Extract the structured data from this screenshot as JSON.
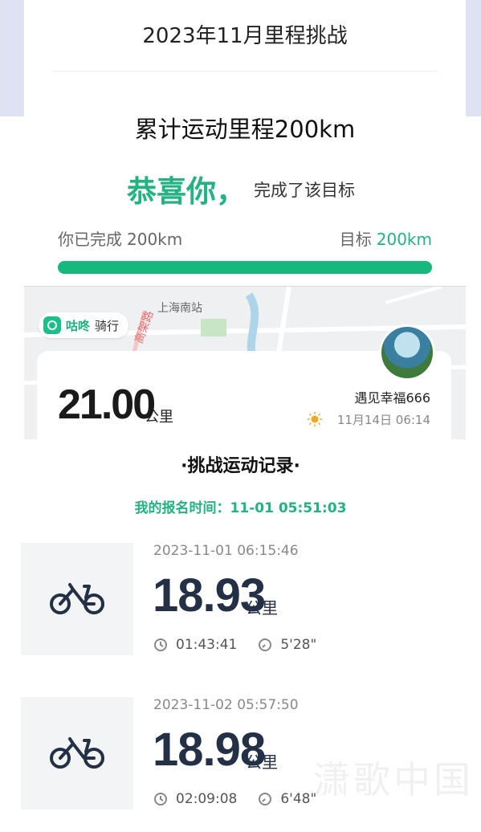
{
  "challenge": {
    "title": "2023年11月里程挑战",
    "goal_text": "累计运动里程200km",
    "congrats": "恭喜你，",
    "congrats_sub": "完成了该目标",
    "completed_label": "你已完成",
    "completed_value": "200km",
    "target_label": "目标",
    "target_value": "200km",
    "progress": 1.0
  },
  "map": {
    "place_label": "上海南站",
    "road_label": "高架路",
    "badge_name": "咕咚",
    "badge_type": "骑行"
  },
  "ride_card": {
    "distance": "21.00",
    "unit": "公里",
    "user": "遇见幸福666",
    "time": "11月14日 06:14"
  },
  "records_section": {
    "title": "·挑战运动记录·",
    "signup_text": "我的报名时间：11-01 05:51:03"
  },
  "records": [
    {
      "datetime": "2023-11-01 06:15:46",
      "distance": "18.93",
      "unit": "公里",
      "duration": "01:43:41",
      "pace": "5'28\""
    },
    {
      "datetime": "2023-11-02 05:57:50",
      "distance": "18.98",
      "unit": "公里",
      "duration": "02:09:08",
      "pace": "6'48\""
    }
  ],
  "watermark": "潇歌中国",
  "colors": {
    "accent": "#22b380",
    "progress": "#16b87e",
    "number": "#233045"
  }
}
